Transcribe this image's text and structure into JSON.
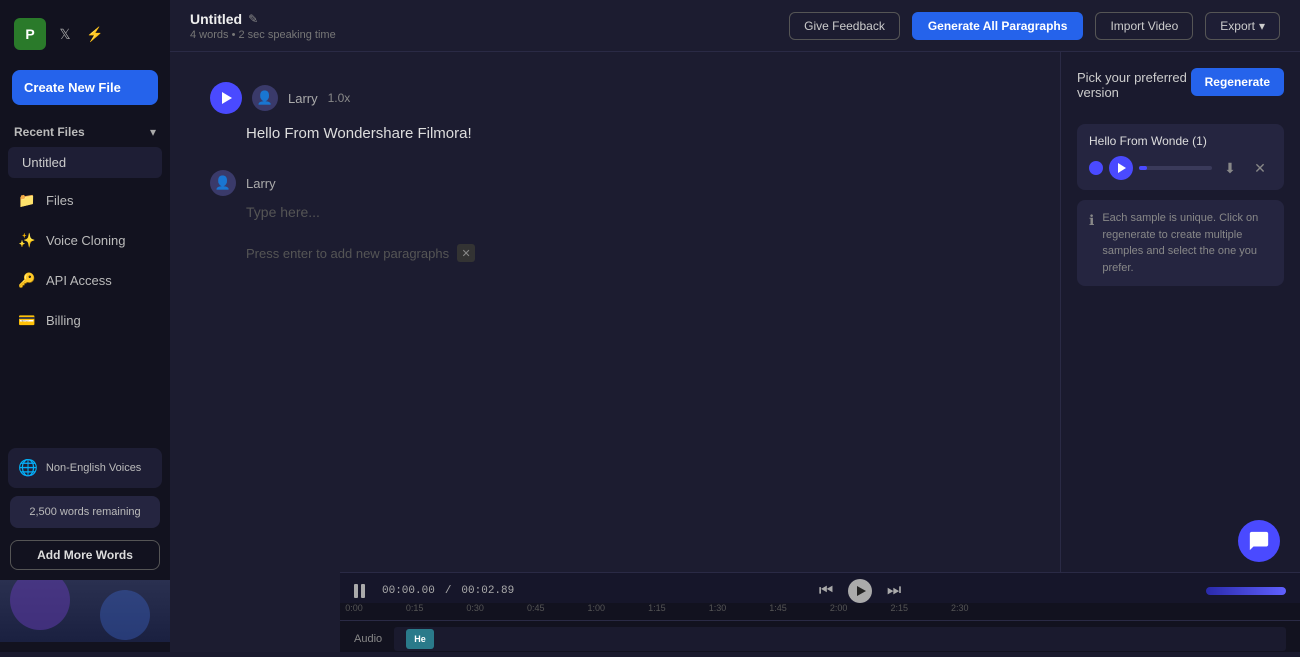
{
  "app": {
    "logo_text": "P",
    "logo_bg": "#2a7a2a"
  },
  "sidebar": {
    "create_new_label": "Create New File",
    "recent_files_label": "Recent Files",
    "recent_file_name": "Untitled",
    "nav_items": [
      {
        "id": "files",
        "label": "Files",
        "icon": "📁"
      },
      {
        "id": "voice-cloning",
        "label": "Voice Cloning",
        "icon": "✨"
      },
      {
        "id": "api-access",
        "label": "API Access",
        "icon": "🔑"
      },
      {
        "id": "billing",
        "label": "Billing",
        "icon": "💳"
      }
    ],
    "non_english_label": "Non-English Voices",
    "words_remaining": "2,500 words remaining",
    "add_words_label": "Add More Words"
  },
  "header": {
    "file_title": "Untitled",
    "file_meta": "4 words • 2 sec speaking time",
    "give_feedback_label": "Give Feedback",
    "generate_label": "Generate All Paragraphs",
    "import_label": "Import Video",
    "export_label": "Export"
  },
  "editor": {
    "paragraph1": {
      "voice_name": "Larry",
      "speed": "1.0x",
      "text": "Hello From Wondershare Filmora!"
    },
    "paragraph2": {
      "voice_name": "Larry",
      "type_placeholder": "Type here..."
    },
    "press_enter_hint": "Press enter to add new paragraphs"
  },
  "version_panel": {
    "title": "Pick your preferred version",
    "regenerate_label": "Regenerate",
    "version1": {
      "title": "Hello From Wonde (1)",
      "progress": 8
    },
    "info_text": "Each sample is unique. Click on regenerate to create multiple samples and select the one you prefer."
  },
  "timeline": {
    "pause_icon": "⏸",
    "time_current": "00:00.00",
    "time_separator": "/",
    "time_total": "00:02.89",
    "prev_label": "⏮",
    "play_label": "▶",
    "next_label": "⏭",
    "track_label": "Audio",
    "clip_label": "He",
    "ruler_marks": [
      "0:00",
      "0:15",
      "0:30",
      "0:45",
      "1:00",
      "1:15",
      "1:30",
      "1:45",
      "2:00",
      "2:15",
      "2:30"
    ]
  }
}
